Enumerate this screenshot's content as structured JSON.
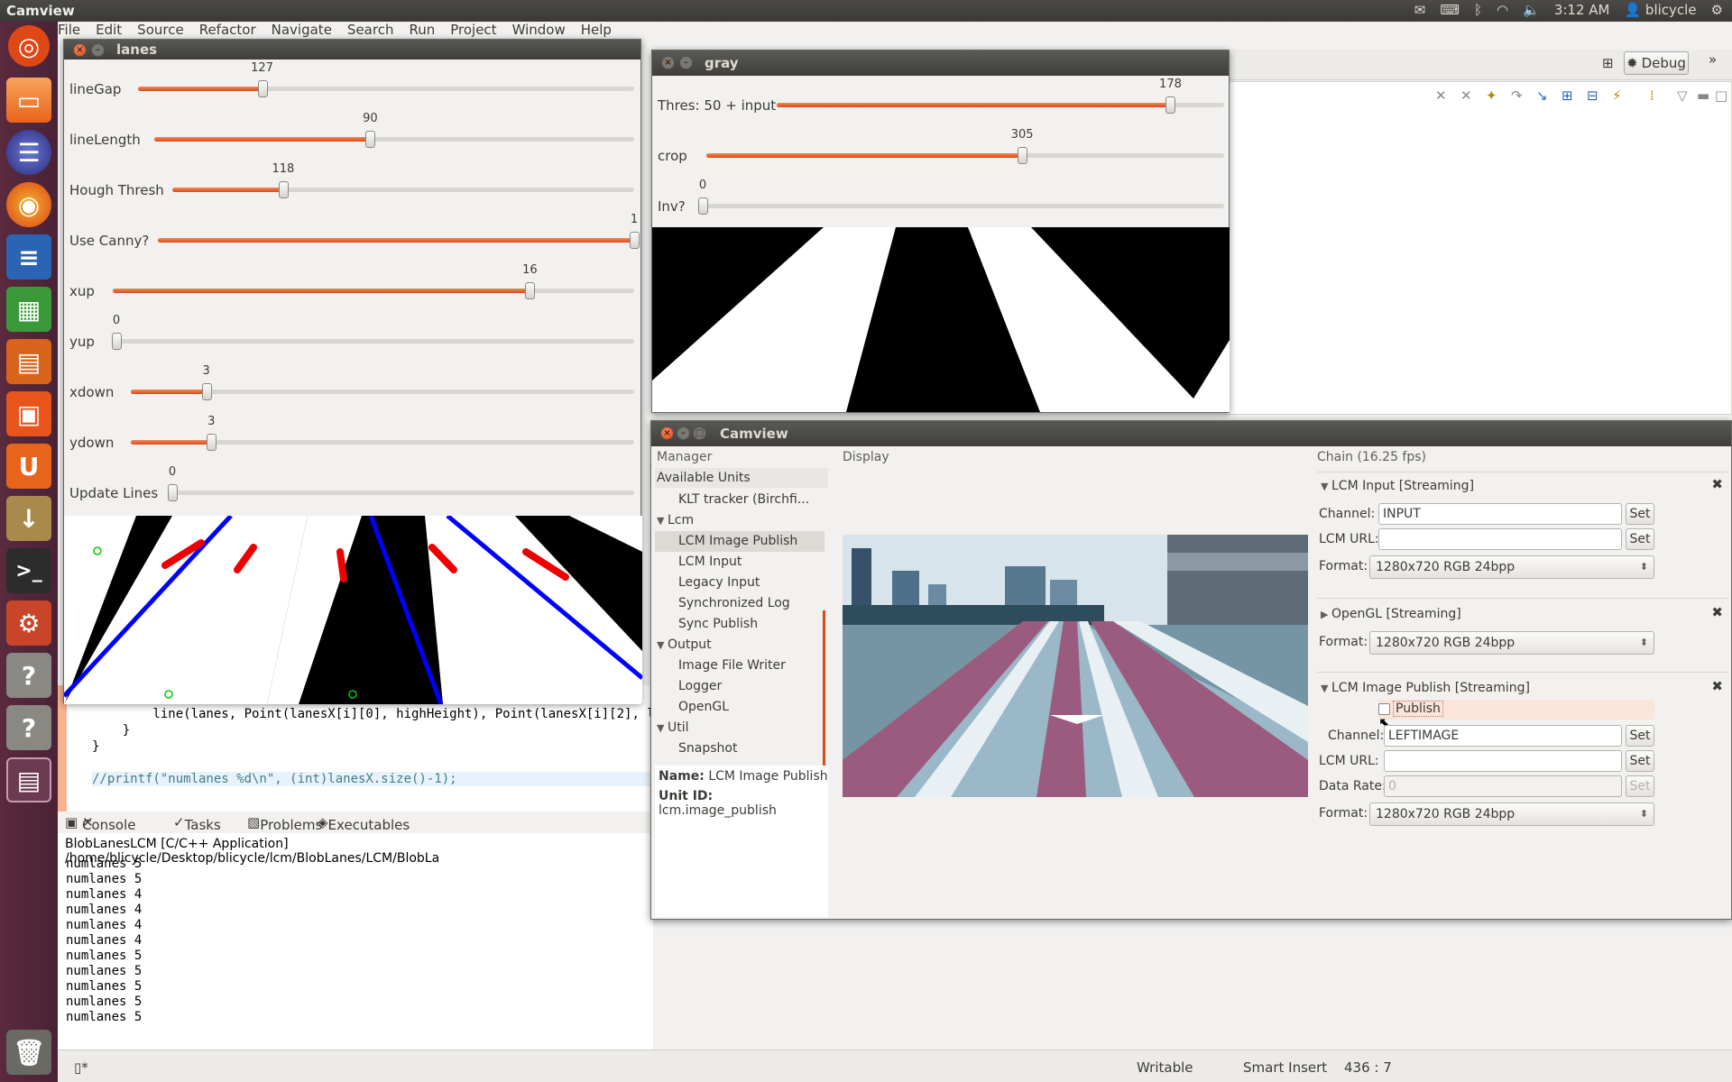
{
  "top_panel": {
    "title": "Camview",
    "clock": "3:12 AM",
    "user": "blicycle"
  },
  "menubar": [
    "File",
    "Edit",
    "Source",
    "Refactor",
    "Navigate",
    "Search",
    "Run",
    "Project",
    "Window",
    "Help"
  ],
  "perspective": {
    "debug_label": "Debug"
  },
  "lanes_window": {
    "title": "lanes",
    "sliders": [
      {
        "label": "lineGap",
        "value": "127",
        "fraction": 0.25
      },
      {
        "label": "lineLength",
        "value": "90",
        "fraction": 0.45
      },
      {
        "label": "Hough Thresh",
        "value": "118",
        "fraction": 0.24
      },
      {
        "label": "Use Canny?",
        "value": "1",
        "fraction": 1.0
      },
      {
        "label": "xup",
        "value": "16",
        "fraction": 0.8
      },
      {
        "label": "yup",
        "value": "0",
        "fraction": 0.0
      },
      {
        "label": "xdown",
        "value": "3",
        "fraction": 0.15
      },
      {
        "label": "ydown",
        "value": "3",
        "fraction": 0.16
      },
      {
        "label": "Update Lines",
        "value": "0",
        "fraction": 0.0
      }
    ]
  },
  "gray_window": {
    "title": "gray",
    "sliders": [
      {
        "label": "Thres: 50 + input",
        "value": "178",
        "fraction": 0.88
      },
      {
        "label": "crop",
        "value": "305",
        "fraction": 0.61
      },
      {
        "label": "Inv?",
        "value": "0",
        "fraction": 0.0
      }
    ]
  },
  "camview_window": {
    "title": "Camview",
    "manager": {
      "header": "Manager",
      "subheader": "Available Units",
      "items": [
        {
          "label": "KLT tracker (Birchfi...",
          "indent": 1
        },
        {
          "label": "Lcm",
          "indent": 0,
          "expander": "▼"
        },
        {
          "label": "LCM Image Publish",
          "indent": 1,
          "selected": true
        },
        {
          "label": "LCM Input",
          "indent": 1
        },
        {
          "label": "Legacy Input",
          "indent": 1
        },
        {
          "label": "Synchronized Log",
          "indent": 1
        },
        {
          "label": "Sync Publish",
          "indent": 1
        },
        {
          "label": "Output",
          "indent": 0,
          "expander": "▼"
        },
        {
          "label": "Image File Writer",
          "indent": 1
        },
        {
          "label": "Logger",
          "indent": 1
        },
        {
          "label": "OpenGL",
          "indent": 1
        },
        {
          "label": "Util",
          "indent": 0,
          "expander": "▼"
        },
        {
          "label": "Snapshot",
          "indent": 1
        }
      ],
      "name_label": "Name:",
      "name_value": "LCM Image Publish",
      "unit_id_label": "Unit ID:",
      "unit_id_value": "lcm.image_publish"
    },
    "display": {
      "header": "Display"
    },
    "chain": {
      "header": "Chain (16.25 fps)",
      "lcm_input": {
        "title": "LCM Input [Streaming]",
        "channel_label": "Channel:",
        "channel_value": "INPUT",
        "url_label": "LCM URL:",
        "url_value": "",
        "format_label": "Format:",
        "format_value": "1280x720 RGB 24bpp",
        "set": "Set"
      },
      "opengl": {
        "title": "OpenGL [Streaming]",
        "format_label": "Format:",
        "format_value": "1280x720 RGB 24bpp"
      },
      "image_publish": {
        "title": "LCM Image Publish [Streaming]",
        "publish_label": "Publish",
        "channel_label": "Channel:",
        "channel_value": "LEFTIMAGE",
        "url_label": "LCM URL:",
        "url_value": "",
        "rate_label": "Data Rate:",
        "rate_value": "0",
        "format_label": "Format:",
        "format_value": "1280x720 RGB 24bpp",
        "set": "Set"
      }
    }
  },
  "editor": {
    "lines": [
      "        line(lanes, Point(lanesX[i][0], highHeight), Point(lanesX[i][2], l",
      "    }",
      "}",
      "",
      "//printf(\"numlanes %d\\n\", (int)lanesX.size()-1);"
    ]
  },
  "console": {
    "tabs": [
      "Console",
      "Tasks",
      "Problems",
      "Executables"
    ],
    "header": "BlobLanesLCM [C/C++ Application] /home/blicycle/Desktop/blicycle/lcm/BlobLanes/LCM/BlobLa",
    "lines": [
      "numlanes 5",
      "numlanes 5",
      "numlanes 4",
      "numlanes 4",
      "numlanes 4",
      "numlanes 4",
      "numlanes 5",
      "numlanes 5",
      "numlanes 5",
      "numlanes 5",
      "numlanes 5"
    ]
  },
  "statusbar": {
    "writable": "Writable",
    "insert": "Smart Insert",
    "position": "436 : 7"
  }
}
